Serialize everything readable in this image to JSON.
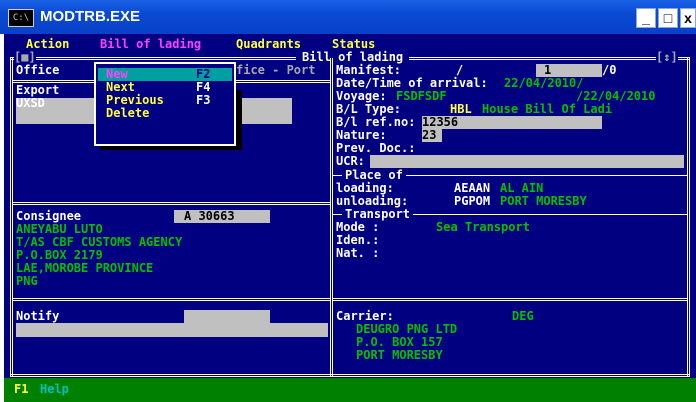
{
  "window": {
    "title": "MODTRB.EXE",
    "icon": "C:\\",
    "minimize": "_",
    "maximize": "□",
    "close": "x"
  },
  "menu": {
    "action": "Action",
    "bill_of_lading": "Bill of lading",
    "quadrants": "Quadrants",
    "status": "Status"
  },
  "dropdown": [
    {
      "label": "New",
      "key": "F2"
    },
    {
      "label": "Next",
      "key": "F4"
    },
    {
      "label": "Previous",
      "key": "F3"
    },
    {
      "label": "Delete",
      "key": ""
    }
  ],
  "frame": {
    "left_marker": "[■]",
    "title": "Bill of lading",
    "right_marker": "[↕]"
  },
  "office": {
    "label": "Office",
    "suffix": "fice - Port"
  },
  "exporter": {
    "label": "Export",
    "code": "UXSD"
  },
  "consignee": {
    "label": "Consignee",
    "code": "A 30663",
    "lines": [
      "ANEYABU LUTO",
      "T/AS CBF CUSTOMS AGENCY",
      "P.O.BOX 2179",
      "LAE,MOROBE PROVINCE",
      "PNG"
    ]
  },
  "notify": {
    "label": "Notify"
  },
  "manifest": {
    "label": "Manifest:",
    "sep": "/",
    "number": "1",
    "suffix": "/0"
  },
  "arrival": {
    "label": "Date/Time of arrival:",
    "value": "22/04/2010/"
  },
  "voyage": {
    "label": "Voyage:",
    "value": "FSDFSDF",
    "date": "/22/04/2010"
  },
  "bl_type": {
    "label": "B/L Type:",
    "code": "HBL",
    "desc": "House Bill Of Ladi"
  },
  "bl_ref": {
    "label": "B/l ref.no:",
    "value": "12356"
  },
  "nature": {
    "label": "Nature:",
    "value": "23"
  },
  "prev_doc": {
    "label": "Prev. Doc.:"
  },
  "ucr": {
    "label": "UCR:"
  },
  "place_of": {
    "title": "Place of",
    "loading_label": "loading:",
    "loading_code": "AEAAN",
    "loading_name": "AL AIN",
    "unloading_label": "unloading:",
    "unloading_code": "PGPOM",
    "unloading_name": "PORT MORESBY"
  },
  "transport": {
    "title": "Transport",
    "mode_label": "Mode :",
    "mode_value": "Sea Transport",
    "iden_label": "Iden.:",
    "nat_label": "Nat. :"
  },
  "carrier": {
    "label": "Carrier:",
    "code": "DEG",
    "lines": [
      "DEUGRO PNG LTD",
      "P.O. BOX 157",
      "PORT MORESBY"
    ]
  },
  "status_bar": {
    "key": "F1",
    "label": "Help"
  },
  "colors": {
    "title_bar": "#0a49d3",
    "console_bg": "#000080",
    "text_green": "#00c000",
    "text_yellow": "#ffff40",
    "status_green": "#008000"
  }
}
